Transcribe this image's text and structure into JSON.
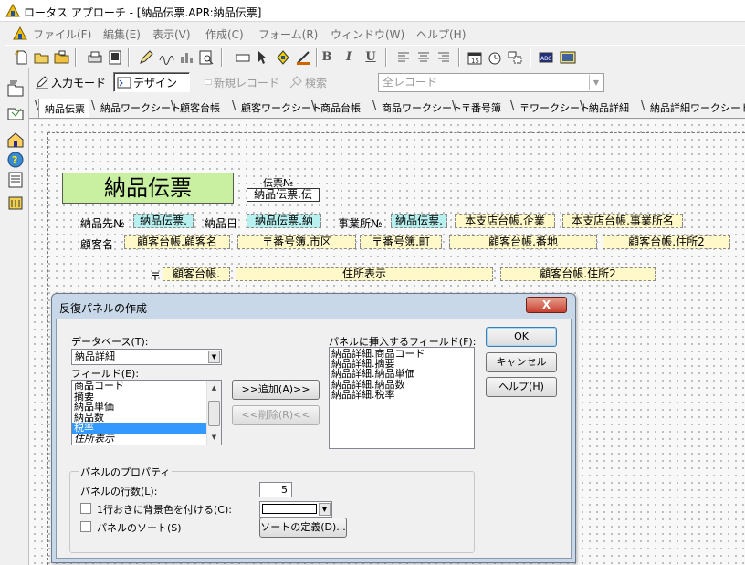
{
  "window": {
    "title": "ロータス アプローチ - [納品伝票.APR:納品伝票]"
  },
  "menu": [
    "ファイル(F)",
    "編集(E)",
    "表示(V)",
    "作成(C)",
    "フォーム(R)",
    "ウィンドウ(W)",
    "ヘルプ(H)"
  ],
  "toolbar": {
    "bold": "B",
    "italic": "I",
    "underline": "U"
  },
  "modebar": {
    "input_mode": "入力モード",
    "design": "デザイン",
    "new_record": "新規レコード",
    "search": "検索",
    "record_filter": "全レコード"
  },
  "tabs": [
    "納品伝票",
    "納品ワークシート",
    "顧客台帳",
    "顧客ワークシート",
    "商品台帳",
    "商品ワークシート",
    "〒番号簿",
    "〒ワークシート",
    "納品詳細",
    "納品詳細ワークシート"
  ],
  "form": {
    "title": "納品伝票",
    "slip_no_label": "伝票№",
    "slip_no_field": "納品伝票.伝",
    "dest_no_label": "納品先№",
    "dest_no_field": "納品伝票.",
    "delivery_date_label": "納品日",
    "delivery_date_field": "納品伝票.納",
    "office_no_label": "事業所№",
    "office_no_field": "納品伝票.",
    "company_field": "本支店台帳.企業",
    "office_name_field": "本支店台帳.事業所名",
    "customer_label": "顧客名",
    "customer_field": "顧客台帳.顧客名",
    "city_field": "〒番号簿.市区",
    "town_field": "〒番号簿.町",
    "street_field": "顧客台帳.番地",
    "address2_field": "顧客台帳.住所2",
    "postal_mark": "〒",
    "postal_field": "顧客台帳.",
    "address_display_field": "住所表示",
    "address2b_field": "顧客台帳.住所2"
  },
  "dialog": {
    "title": "反復パネルの作成",
    "close": "X",
    "database_label": "データベース(T):",
    "database_value": "納品詳細",
    "fields_label": "フィールド(E):",
    "fields": [
      "商品コード",
      "摘要",
      "納品単価",
      "納品数",
      "税率",
      "住所表示"
    ],
    "selected_field": "税率",
    "add_button": ">>追加(A)>>",
    "remove_button": "<<削除(R)<<",
    "panel_fields_label": "パネルに挿入するフィールド(F):",
    "panel_fields": [
      "納品詳細.商品コード",
      "納品詳細.摘要",
      "納品詳細.納品単価",
      "納品詳細.納品数",
      "納品詳細.税率"
    ],
    "ok": "OK",
    "cancel": "キャンセル",
    "help": "ヘルプ(H)",
    "properties_title": "パネルのプロパティ",
    "rows_label": "パネルの行数(L):",
    "rows_value": "5",
    "alt_bg_label": "1行おきに背景色を付ける(C):",
    "sort_label": "パネルのソート(S)",
    "sort_define": "ソートの定義(D)..."
  },
  "colors": {
    "title_field_bg": "#c8f0a0",
    "field_bg": "#fff8c8",
    "selected_field_bg": "#b8f0f0",
    "list_selection": "#3399ff"
  }
}
